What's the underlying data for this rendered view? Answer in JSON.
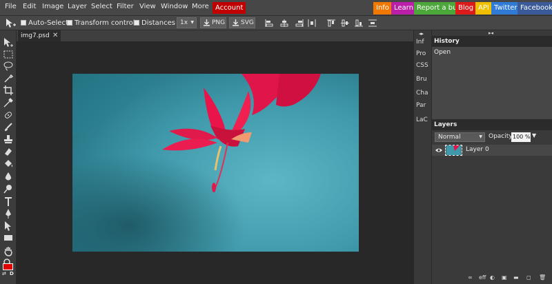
{
  "menu": {
    "items": [
      "File",
      "Edit",
      "Image",
      "Layer",
      "Select",
      "Filter",
      "View",
      "Window",
      "More"
    ],
    "account": "Account",
    "external": [
      {
        "label": "Info",
        "color": "#f07800"
      },
      {
        "label": "Learn",
        "color": "#bb1faa"
      },
      {
        "label": "Report a bug",
        "color": "#4ca73b"
      },
      {
        "label": "Blog",
        "color": "#dd1a1a"
      },
      {
        "label": "API",
        "color": "#f0c000"
      },
      {
        "label": "Twitter",
        "color": "#2e7ad4"
      },
      {
        "label": "Facebook",
        "color": "#3a5a9a"
      }
    ]
  },
  "options": {
    "auto_select": "Auto-Select",
    "transform_controls": "Transform controls",
    "distances": "Distances",
    "scale": "1x",
    "png": "PNG",
    "svg": "SVG"
  },
  "document": {
    "tab_name": "img7.psd"
  },
  "mini_panels": [
    "Inf",
    "Pro",
    "CSS",
    "Bru",
    "Cha",
    "Par",
    "LaC"
  ],
  "history": {
    "title": "History",
    "entries": [
      "Open"
    ]
  },
  "layers": {
    "title": "Layers",
    "blend_mode": "Normal",
    "opacity_label": "Opacity:",
    "opacity_value": "100 %",
    "items": [
      {
        "name": "Layer 0"
      }
    ],
    "footer_link": "eff"
  },
  "colors": {
    "foreground": "#e00000",
    "background": "#000000"
  }
}
